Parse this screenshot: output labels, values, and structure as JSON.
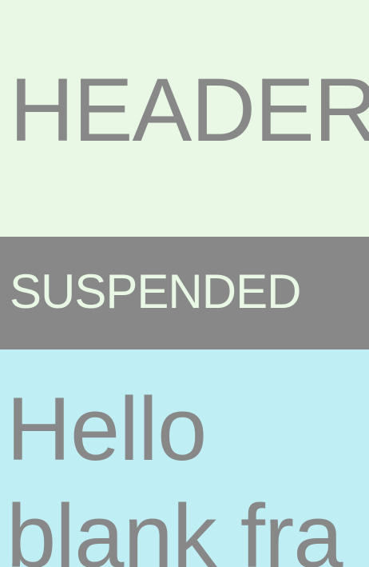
{
  "header": {
    "title": "HEADER",
    "background": "#e8f8e4",
    "text_color": "#888888"
  },
  "status": {
    "label": "SUSPENDED",
    "background": "#888888",
    "text_color": "#e8f8e4"
  },
  "content": {
    "background": "#bfeef5",
    "text_color": "#888888",
    "lines": [
      "Hello",
      "blank fra"
    ]
  }
}
